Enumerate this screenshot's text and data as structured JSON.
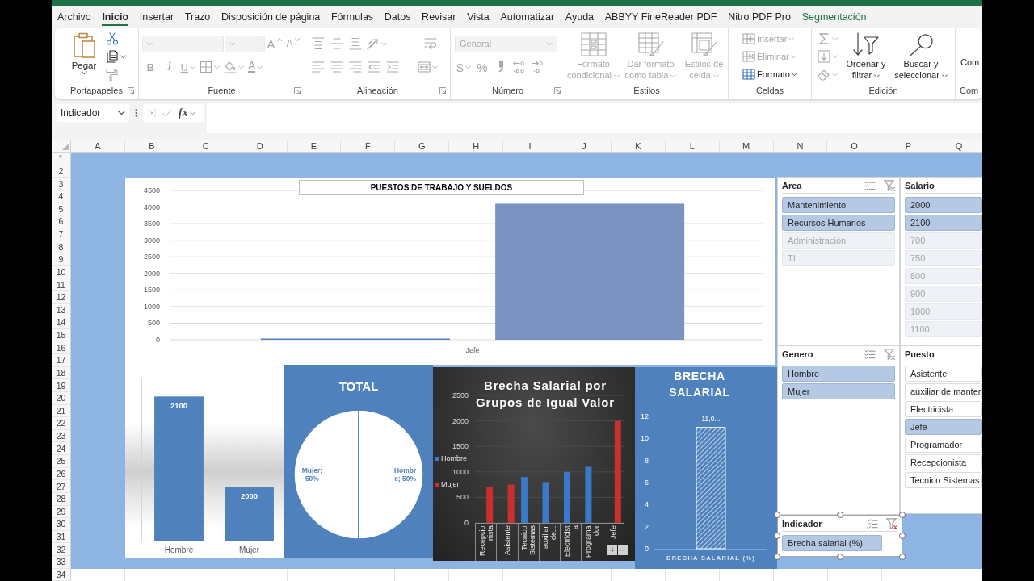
{
  "menu_tabs": [
    {
      "label": "Archivo",
      "selected": false,
      "kind": "standard"
    },
    {
      "label": "Inicio",
      "selected": true,
      "kind": "standard"
    },
    {
      "label": "Insertar",
      "selected": false,
      "kind": "standard"
    },
    {
      "label": "Trazo",
      "selected": false,
      "kind": "standard"
    },
    {
      "label": "Disposición de página",
      "selected": false,
      "kind": "standard"
    },
    {
      "label": "Fórmulas",
      "selected": false,
      "kind": "standard"
    },
    {
      "label": "Datos",
      "selected": false,
      "kind": "standard"
    },
    {
      "label": "Revisar",
      "selected": false,
      "kind": "standard"
    },
    {
      "label": "Vista",
      "selected": false,
      "kind": "standard"
    },
    {
      "label": "Automatizar",
      "selected": false,
      "kind": "standard"
    },
    {
      "label": "Ayuda",
      "selected": false,
      "kind": "standard"
    },
    {
      "label": "ABBYY FineReader PDF",
      "selected": false,
      "kind": "standard"
    },
    {
      "label": "Nitro PDF Pro",
      "selected": false,
      "kind": "standard"
    },
    {
      "label": "Segmentación",
      "selected": false,
      "kind": "contextual"
    }
  ],
  "ribbon": [
    {
      "label": "Portapapeles",
      "launcher": true,
      "sections": [
        {
          "kind": "large",
          "controls": [
            {
              "kind": "paste",
              "label": "Pegar",
              "disabled": false
            }
          ]
        },
        {
          "kind": "stack",
          "controls": [
            {
              "kind": "cut",
              "disabled": false
            },
            {
              "kind": "copy",
              "disabled": false
            },
            {
              "kind": "format-painter",
              "disabled": true
            }
          ]
        }
      ]
    },
    {
      "label": "Fuente",
      "launcher": true,
      "sections": [
        {
          "kind": "rows",
          "rows": [
            [
              {
                "kind": "font-name",
                "disabled": true
              },
              {
                "kind": "font-size",
                "disabled": true
              },
              {
                "kind": "grow-font",
                "label": "A",
                "disabled": true
              },
              {
                "kind": "shrink-font",
                "label": "A",
                "disabled": true
              }
            ],
            [
              {
                "kind": "bold",
                "label": "B",
                "disabled": true
              },
              {
                "kind": "italic",
                "label": "I",
                "disabled": true
              },
              {
                "kind": "underline",
                "label": "U",
                "disabled": true
              },
              {
                "kind": "borders",
                "disabled": true
              },
              {
                "kind": "fill-color",
                "disabled": true
              },
              {
                "kind": "font-color",
                "label": "A",
                "disabled": true
              }
            ]
          ]
        }
      ]
    },
    {
      "label": "Alineación",
      "launcher": true,
      "sections": [
        {
          "kind": "rows",
          "rows": [
            [
              {
                "kind": "align-top",
                "disabled": true
              },
              {
                "kind": "align-middle",
                "disabled": true
              },
              {
                "kind": "align-bottom",
                "disabled": true
              },
              {
                "kind": "orientation",
                "disabled": true
              },
              {
                "kind": "wrap-text",
                "disabled": true
              }
            ],
            [
              {
                "kind": "align-left",
                "disabled": true
              },
              {
                "kind": "align-center",
                "disabled": true
              },
              {
                "kind": "align-right",
                "disabled": true
              },
              {
                "kind": "indent-decrease",
                "disabled": true
              },
              {
                "kind": "indent-increase",
                "disabled": true
              },
              {
                "kind": "merge",
                "disabled": true
              }
            ]
          ]
        }
      ]
    },
    {
      "label": "Número",
      "launcher": true,
      "sections": [
        {
          "kind": "rows",
          "rows": [
            [
              {
                "kind": "number-format",
                "label": "General",
                "disabled": true
              }
            ],
            [
              {
                "kind": "currency",
                "label": "$",
                "disabled": true
              },
              {
                "kind": "percent",
                "label": "%",
                "disabled": true
              },
              {
                "kind": "comma-style",
                "disabled": true
              },
              {
                "kind": "decimal-increase",
                "disabled": true
              },
              {
                "kind": "decimal-decrease",
                "disabled": true
              }
            ]
          ]
        }
      ]
    },
    {
      "label": "Estilos",
      "launcher": false,
      "sections": [
        {
          "kind": "large",
          "controls": [
            {
              "kind": "conditional-format",
              "label": "Formato condicional",
              "disabled": true
            },
            {
              "kind": "format-table",
              "label": "Dar formato como tabla",
              "disabled": true
            },
            {
              "kind": "cell-styles",
              "label": "Estilos de celda",
              "disabled": true
            }
          ]
        }
      ]
    },
    {
      "label": "Celdas",
      "launcher": false,
      "sections": [
        {
          "kind": "stack",
          "controls": [
            {
              "kind": "insert-cells",
              "label": "Insertar",
              "disabled": true
            },
            {
              "kind": "delete-cells",
              "label": "Eliminar",
              "disabled": true
            },
            {
              "kind": "format-cells",
              "label": "Formato",
              "disabled": false
            }
          ]
        }
      ]
    },
    {
      "label": "Edición",
      "launcher": false,
      "sections": [
        {
          "kind": "stack",
          "controls": [
            {
              "kind": "autosum",
              "disabled": true
            },
            {
              "kind": "fill",
              "disabled": true
            },
            {
              "kind": "clear",
              "disabled": true
            }
          ]
        },
        {
          "kind": "large",
          "controls": [
            {
              "kind": "sort-filter",
              "label": "Ordenar y filtrar",
              "disabled": false
            },
            {
              "kind": "find-select",
              "label": "Buscar y seleccionar",
              "disabled": false
            }
          ]
        }
      ]
    },
    {
      "label": "Com",
      "launcher": false,
      "sections": [
        {
          "kind": "large",
          "controls": [
            {
              "kind": "addins",
              "label": "Com",
              "disabled": false
            }
          ]
        }
      ]
    }
  ],
  "formula_bar": {
    "name_box": "Indicador",
    "edit_disabled": true,
    "function_label": "fx"
  },
  "column_headers": [
    "A",
    "B",
    "C",
    "D",
    "E",
    "F",
    "G",
    "H",
    "I",
    "J",
    "K",
    "L",
    "M",
    "N",
    "O",
    "P",
    "Q"
  ],
  "row_headers": [
    "1",
    "2",
    "3",
    "4",
    "5",
    "6",
    "7",
    "8",
    "9",
    "10",
    "11",
    "12",
    "13",
    "14",
    "15",
    "16",
    "17",
    "18",
    "19",
    "20",
    "21",
    "22",
    "23",
    "24",
    "25",
    "26",
    "27",
    "28",
    "29",
    "30",
    "31",
    "32",
    "33",
    "34"
  ],
  "charts": [
    {
      "chart_data": {
        "type": "bar",
        "title": "PUESTOS DE TRABAJO Y SUELDOS",
        "categories": [
          "Jefe"
        ],
        "series": [
          {
            "color": "#4f81bd",
            "values": [
              0
            ]
          },
          {
            "color": "#7a93c1",
            "values": [
              4100
            ]
          }
        ],
        "ylim": [
          0,
          4500
        ],
        "yticks": [
          0,
          500,
          1000,
          1500,
          2000,
          2500,
          3000,
          3500,
          4000,
          4500
        ],
        "grid": true
      }
    },
    {
      "chart_data": {
        "type": "bar",
        "categories": [
          "Hombre",
          "Mujer"
        ],
        "values": [
          2100,
          2000
        ],
        "color": "#4f81bd",
        "data_labels": true,
        "ylim": [
          1940,
          2120
        ]
      }
    },
    {
      "chart_data": {
        "type": "pie",
        "title": "TOTAL",
        "values": [
          50,
          50
        ],
        "colors": [
          "#ffffff",
          "#ffffff"
        ],
        "value_labels": [
          "Mujer; 50%",
          "Hombre; 50%"
        ]
      }
    },
    {
      "chart_data": {
        "type": "bar",
        "title": "Brecha Salarial por Grupos de Igual Valor",
        "categories": [
          "Recepcionista",
          "Asistente",
          "Tecnico Sistemas",
          "auxiliar de...",
          "Electricista",
          "Programador",
          "Jefe"
        ],
        "series": [
          {
            "name": "Hombre",
            "color": "#3b78c8",
            "values": [
              null,
              null,
              900,
              800,
              1000,
              1100,
              null
            ]
          },
          {
            "name": "Mujer",
            "color": "#c8302f",
            "values": [
              700,
              750,
              null,
              null,
              null,
              null,
              2000
            ]
          }
        ],
        "ylim": [
          0,
          2500
        ],
        "yticks": [
          0,
          500,
          1000,
          1500,
          2000,
          2500
        ],
        "grid": true,
        "legend": "left"
      },
      "field_buttons": [
        "+",
        "−"
      ]
    },
    {
      "chart_data": {
        "type": "bar",
        "title": "BRECHA SALARIAL",
        "categories": [
          null
        ],
        "values": [
          11
        ],
        "color": "#ffffff",
        "value_labels": [
          "11,0..."
        ],
        "xlabel": "BRECHA SALARIAL (%)",
        "ylim": [
          0,
          12
        ],
        "yticks": [
          0,
          2,
          4,
          6,
          8,
          10,
          12
        ]
      }
    }
  ],
  "slicers": [
    {
      "title": "Area",
      "filtered": false,
      "active": false,
      "items": [
        {
          "label": "Mantenimiento",
          "selected": true,
          "disabled": false
        },
        {
          "label": "Recursos Humanos",
          "selected": true,
          "disabled": false
        },
        {
          "label": "Administración",
          "selected": false,
          "disabled": true
        },
        {
          "label": "TI",
          "selected": false,
          "disabled": true
        }
      ]
    },
    {
      "title": "Salario",
      "active": false,
      "items": [
        {
          "label": "2000",
          "selected": true,
          "disabled": false
        },
        {
          "label": "2100",
          "selected": true,
          "disabled": false
        },
        {
          "label": "700",
          "selected": false,
          "disabled": true
        },
        {
          "label": "750",
          "selected": false,
          "disabled": true
        },
        {
          "label": "800",
          "selected": false,
          "disabled": true
        },
        {
          "label": "900",
          "selected": false,
          "disabled": true
        },
        {
          "label": "1000",
          "selected": false,
          "disabled": true
        },
        {
          "label": "1100",
          "selected": false,
          "disabled": true
        }
      ]
    },
    {
      "title": "Genero",
      "filtered": false,
      "active": false,
      "items": [
        {
          "label": "Hombre",
          "selected": true,
          "disabled": false
        },
        {
          "label": "Mujer",
          "selected": true,
          "disabled": false
        }
      ]
    },
    {
      "title": "Puesto",
      "active": false,
      "items": [
        {
          "label": "Asistente",
          "selected": false,
          "disabled": false
        },
        {
          "label": "auxiliar de manter",
          "selected": false,
          "disabled": false
        },
        {
          "label": "Electricista",
          "selected": false,
          "disabled": false
        },
        {
          "label": "Jefe",
          "selected": true,
          "disabled": false
        },
        {
          "label": "Programador",
          "selected": false,
          "disabled": false
        },
        {
          "label": "Recepcionista",
          "selected": false,
          "disabled": false
        },
        {
          "label": "Tecnico Sistemas",
          "selected": false,
          "disabled": false
        }
      ]
    },
    {
      "title": "Indicador",
      "filtered": true,
      "active": true,
      "items": [
        {
          "label": "Brecha salarial (%)",
          "selected": true,
          "disabled": false
        }
      ]
    }
  ]
}
